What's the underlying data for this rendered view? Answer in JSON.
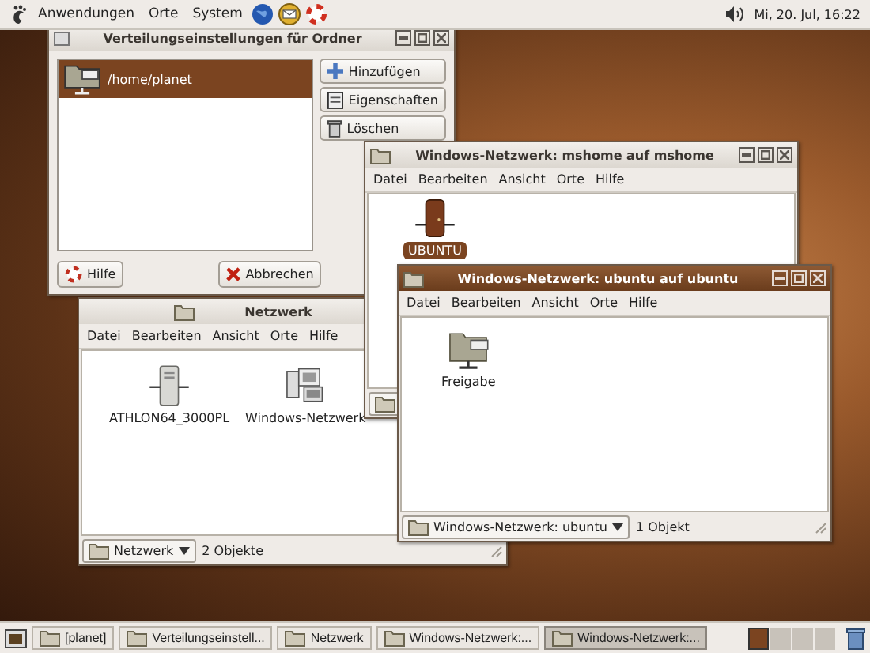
{
  "top_panel": {
    "menus": [
      "Anwendungen",
      "Orte",
      "System"
    ],
    "clock": "Mi, 20. Jul, 16:22"
  },
  "windows": [
    {
      "kind": "share_dialog",
      "title": "Verteilungseinstellungen für Ordner",
      "active": false,
      "shares": [
        {
          "path": "/home/planet",
          "selected": true
        }
      ],
      "side_buttons": [
        "Hinzufügen",
        "Eigenschaften",
        "Löschen"
      ],
      "bottom_buttons": [
        "Hilfe",
        "Abbrechen"
      ]
    },
    {
      "kind": "file_browser",
      "title": "Netzwerk",
      "active": false,
      "menu": [
        "Datei",
        "Bearbeiten",
        "Ansicht",
        "Orte",
        "Hilfe"
      ],
      "items": [
        {
          "label": "ATHLON64_3000PL",
          "kind": "server",
          "selected": false
        },
        {
          "label": "Windows-Netzwerk",
          "kind": "network",
          "selected": false
        }
      ],
      "location": "Netzwerk",
      "status": "2 Objekte"
    },
    {
      "kind": "file_browser",
      "title": "Windows-Netzwerk: mshome auf mshome",
      "active": false,
      "menu": [
        "Datei",
        "Bearbeiten",
        "Ansicht",
        "Orte",
        "Hilfe"
      ],
      "items": [
        {
          "label": "UBUNTU",
          "kind": "host",
          "selected": true
        }
      ]
    },
    {
      "kind": "file_browser",
      "title": "Windows-Netzwerk: ubuntu auf ubuntu",
      "active": true,
      "menu": [
        "Datei",
        "Bearbeiten",
        "Ansicht",
        "Orte",
        "Hilfe"
      ],
      "items": [
        {
          "label": "Freigabe",
          "kind": "share",
          "selected": false
        }
      ],
      "location": "Windows-Netzwerk: ubuntu",
      "status": "1 Objekt"
    }
  ],
  "taskbar": {
    "tasks": [
      {
        "label": "[planet]",
        "selected": false
      },
      {
        "label": "Verteilungseinstell...",
        "selected": false
      },
      {
        "label": "Netzwerk",
        "selected": false
      },
      {
        "label": "Windows-Netzwerk:...",
        "selected": false
      },
      {
        "label": "Windows-Netzwerk:...",
        "selected": true
      }
    ],
    "workspaces": [
      {
        "selected": true
      },
      {
        "selected": false
      },
      {
        "selected": false
      },
      {
        "selected": false
      }
    ]
  }
}
